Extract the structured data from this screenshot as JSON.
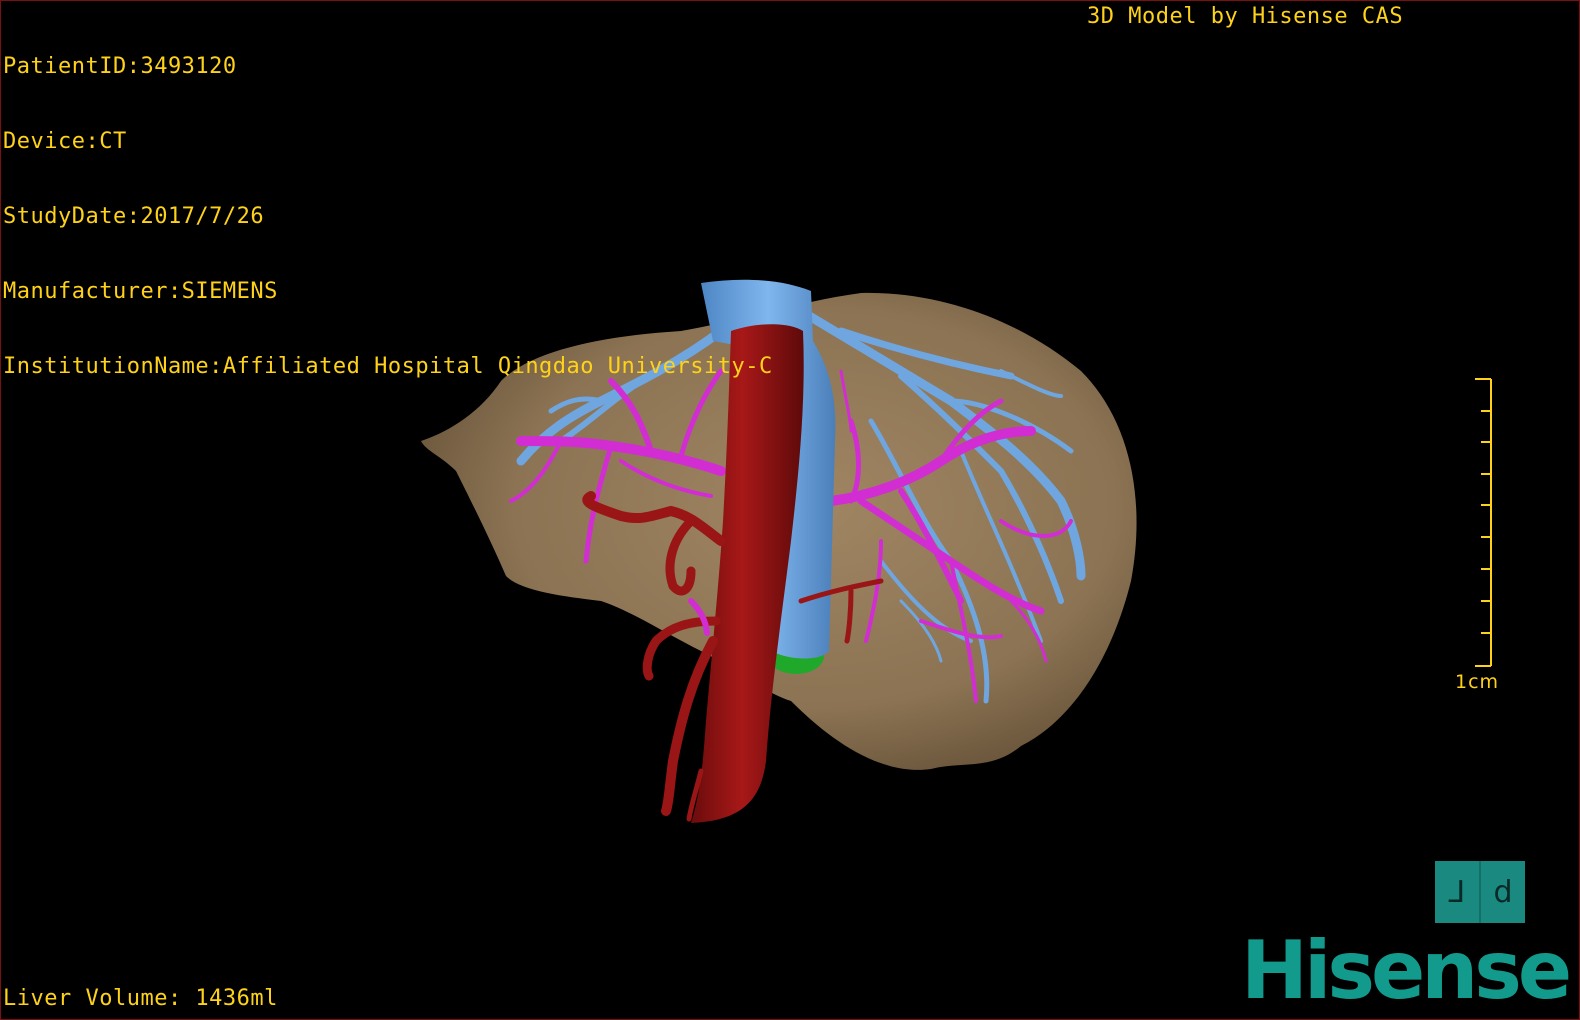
{
  "patient_info": {
    "patient_id": "PatientID:3493120",
    "device": "Device:CT",
    "study_date": "StudyDate:2017/7/26",
    "manufacturer": "Manufacturer:SIEMENS",
    "institution": "InstitutionName:Affiliated Hospital Qingdao University-C"
  },
  "model_credit": "3D Model by Hisense CAS",
  "liver_volume": "Liver Volume: 1436ml",
  "scale": {
    "label": "1cm",
    "ticks": 10
  },
  "orientation_cube": {
    "left_glyph": "⅃",
    "right_glyph": "d"
  },
  "logo_text": "Hisense",
  "colors": {
    "overlay_text": "#ffd21a",
    "liver": "#8b7353",
    "hepatic_vein": "#6fa6e0",
    "portal_vein": "#d22dd2",
    "artery": "#9a1515",
    "gallbladder": "#1fa82a",
    "brand": "#129a8c",
    "border": "#7a1010"
  },
  "icons": {
    "view_cube": "orientation-cube-icon",
    "scale": "ruler-scale-icon"
  }
}
